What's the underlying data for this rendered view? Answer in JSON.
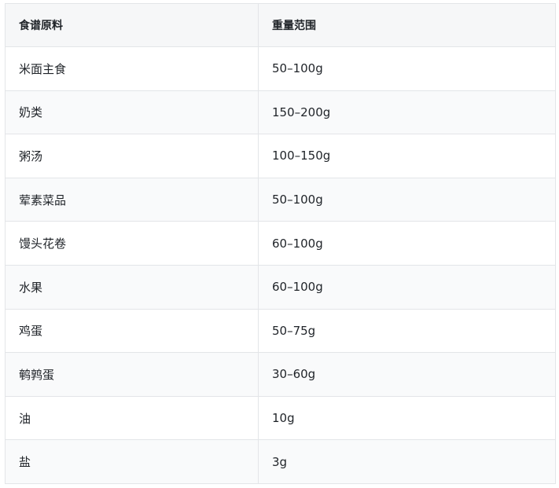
{
  "table": {
    "headers": [
      "食谱原料",
      "重量范围"
    ],
    "rows": [
      [
        "米面主食",
        "50–100g"
      ],
      [
        "奶类",
        "150–200g"
      ],
      [
        "粥汤",
        "100–150g"
      ],
      [
        "荤素菜品",
        "50–100g"
      ],
      [
        "馒头花卷",
        "60–100g"
      ],
      [
        "水果",
        "60–100g"
      ],
      [
        "鸡蛋",
        "50–75g"
      ],
      [
        "鹌鹑蛋",
        "30–60g"
      ],
      [
        "油",
        "10g"
      ],
      [
        "盐",
        "3g"
      ]
    ]
  }
}
